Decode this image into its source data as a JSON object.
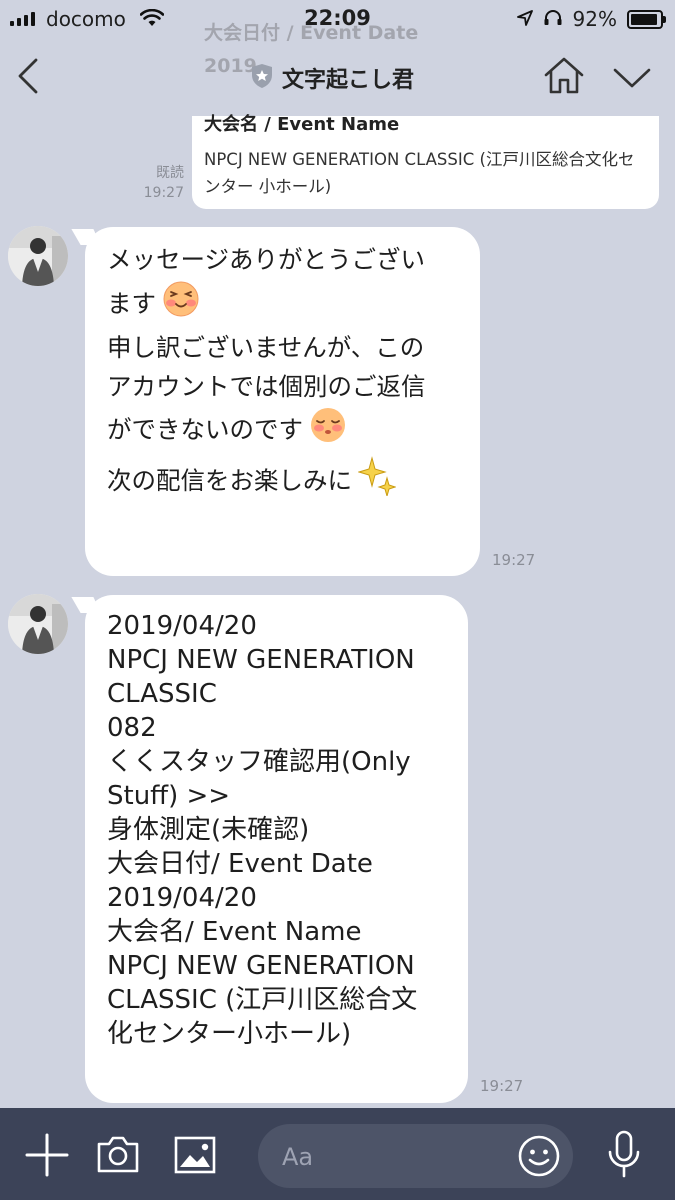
{
  "status_bar": {
    "carrier": "docomo",
    "time": "22:09",
    "battery_percent": "92%",
    "battery_level": 0.92,
    "icons": [
      "signal-icon",
      "wifi-icon",
      "location-icon",
      "headphones-icon",
      "battery-icon"
    ]
  },
  "header": {
    "title": "文字起こし君",
    "icons": [
      "back-chevron-icon",
      "shield-badge-icon",
      "home-icon",
      "chevron-down-icon"
    ]
  },
  "previous_message": {
    "faded_line1": "大会日付 / Event Date",
    "faded_line2": "2019",
    "heading": "大会名 / Event Name",
    "body": "NPCJ NEW GENERATION CLASSIC (江戸川区総合文化センター 小ホール)",
    "read_label": "既読",
    "time": "19:27"
  },
  "messages": [
    {
      "sender": "bot",
      "text": "メッセージありがとうござい\nます",
      "emoji1": "smiling-blush-icon",
      "text2": "\n申し訳ございませんが、この\nアカウントでは個別のご返信\nができないのです",
      "emoji2": "relieved-blush-icon",
      "text3": "\n次の配信をお楽しみに",
      "emoji3": "sparkles-icon",
      "time": "19:27"
    },
    {
      "sender": "bot",
      "text": "2019/04/20\nNPCJ NEW GENERATION\nCLASSIC\n082\nくくスタッフ確認用(Only\nStuff) >>\n身体測定(未確認)\n大会日付/ Event Date\n2019/04/20\n大会名/ Event Name\nNPCJ NEW GENERATION\nCLASSIC (江戸川区総合文\n化センター小ホール)",
      "time": "19:27"
    }
  ],
  "input_bar": {
    "placeholder": "Aa",
    "icons": [
      "plus-icon",
      "camera-icon",
      "image-icon",
      "emoji-icon",
      "microphone-icon"
    ]
  },
  "colors": {
    "chat_background": "#cfd3e0",
    "bubble": "#ffffff",
    "input_bar": "#3c4358",
    "meta_text": "#8a8d96"
  }
}
